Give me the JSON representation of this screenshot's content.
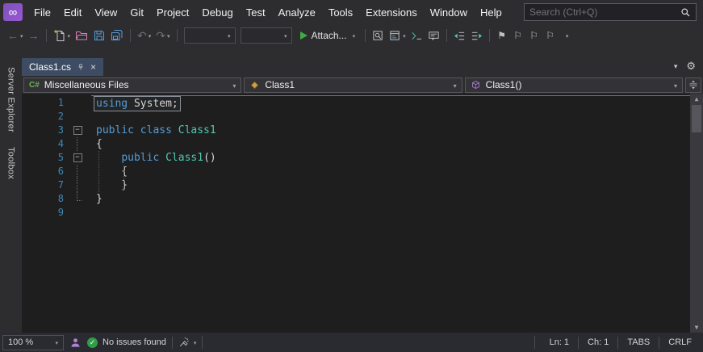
{
  "menu": {
    "items": [
      "File",
      "Edit",
      "View",
      "Git",
      "Project",
      "Debug",
      "Test",
      "Analyze",
      "Tools",
      "Extensions",
      "Window",
      "Help"
    ],
    "search_placeholder": "Search (Ctrl+Q)"
  },
  "toolbar": {
    "attach_label": "Attach...",
    "configuration_value": "",
    "platform_value": ""
  },
  "side_panel": {
    "tabs": [
      "Server Explorer",
      "Toolbox"
    ]
  },
  "document_tabs": {
    "active": "Class1.cs"
  },
  "navigation_bar": {
    "project": "Miscellaneous Files",
    "type": "Class1",
    "member": "Class1()"
  },
  "editor": {
    "lines": [
      {
        "num": "1",
        "boxed": true,
        "fold": "",
        "segments": [
          {
            "style": "kw",
            "text": "using"
          },
          {
            "style": "pl",
            "text": " System;"
          }
        ]
      },
      {
        "num": "2",
        "boxed": false,
        "fold": "",
        "segments": []
      },
      {
        "num": "3",
        "boxed": false,
        "fold": "box",
        "segments": [
          {
            "style": "kw",
            "text": "public class "
          },
          {
            "style": "ty",
            "text": "Class1"
          }
        ]
      },
      {
        "num": "4",
        "boxed": false,
        "fold": "line",
        "segments": [
          {
            "style": "pl",
            "text": "{"
          }
        ]
      },
      {
        "num": "5",
        "boxed": false,
        "fold": "box",
        "segments": [
          {
            "style": "pl",
            "text": "    "
          },
          {
            "style": "kw",
            "text": "public "
          },
          {
            "style": "ty",
            "text": "Class1"
          },
          {
            "style": "pl",
            "text": "()"
          }
        ]
      },
      {
        "num": "6",
        "boxed": false,
        "fold": "line",
        "segments": [
          {
            "style": "pl",
            "text": "    {"
          }
        ]
      },
      {
        "num": "7",
        "boxed": false,
        "fold": "line",
        "segments": [
          {
            "style": "pl",
            "text": "    }"
          }
        ]
      },
      {
        "num": "8",
        "boxed": false,
        "fold": "corner",
        "segments": [
          {
            "style": "pl",
            "text": "}"
          }
        ]
      },
      {
        "num": "9",
        "boxed": false,
        "fold": "",
        "segments": []
      }
    ]
  },
  "status": {
    "zoom": "100 %",
    "message": "No issues found",
    "line": "Ln: 1",
    "column": "Ch: 1",
    "indent_mode": "TABS",
    "line_ending": "CRLF"
  },
  "icons": {
    "logo_infinity": "∞",
    "dropdown": "▾",
    "gear": "⚙",
    "close": "×",
    "check": "✓",
    "nav_back": "←",
    "nav_forward": "→",
    "undo": "↶",
    "redo": "↷",
    "bookmark": "⚑",
    "bookmark_outline": "⚐",
    "scroll_up": "▲",
    "scroll_down": "▼",
    "fold_minus": "−",
    "csharp_badge": "C#"
  },
  "colors": {
    "keyword_blue": "#569CD6",
    "type_teal": "#4EC9B0",
    "line_number_blue": "#3F88B5",
    "success_green": "#2F9E44",
    "attach_green": "#3FAB45",
    "logo_purple": "#8A57C9",
    "liveshare_purple": "#B180D7",
    "active_tab_blue": "#3E4C63",
    "editor_background": "#1E1E1E",
    "chrome_background": "#2D2D30"
  }
}
